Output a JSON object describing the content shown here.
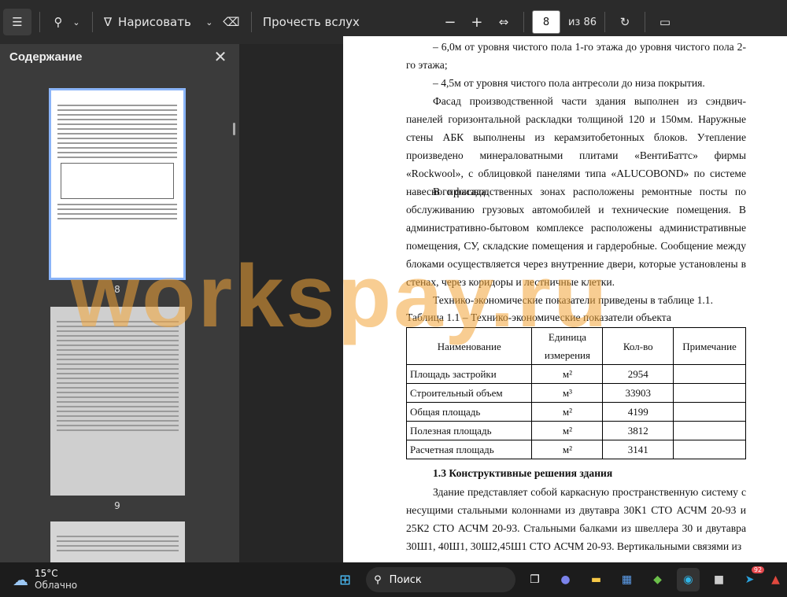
{
  "toolbar": {
    "draw_label": "Нарисовать",
    "read_aloud_label": "Прочесть вслух",
    "page_current": "8",
    "page_total": "из 86",
    "minus": "−",
    "plus": "+"
  },
  "sidebar": {
    "title": "Содержание",
    "pages": [
      "8",
      "9"
    ]
  },
  "document": {
    "lines": [
      "– 6,0м от уровня чистого пола 1-го этажа до уровня чистого пола 2-го этажа;",
      "– 4,5м от уровня чистого пола антресоли до низа покрытия.",
      "Фасад производственной части здания выполнен из сэндвич-панелей горизонтальной раскладки толщиной 120 и 150мм. Наружные стены АБК выполнены из керамзитобетонных блоков. Утепление произведено минераловатными плитами «ВентиБаттс» фирмы «Rockwool», с облицовкой панелями типа «ALUCOBOND» по системе навесного фасада.",
      "В производственных зонах расположены ремонтные посты по обслуживанию грузовых автомобилей и технические помещения. В административно-бытовом комплексе расположены административные помещения, СУ, складские помещения и гардеробные. Сообщение между блоками осуществляется через внутренние двери, которые установлены в стенах, через коридоры и лестничные клетки.",
      "Технико-экономические показатели приведены в таблице 1.1.",
      "Таблица 1.1 – Технико-экономические показатели объекта",
      "1.3 Конструктивные решения здания",
      "Здание представляет собой каркасную пространственную систему с несущими стальными колоннами из двутавра 30К1 СТО АСЧМ 20-93 и 25К2 СТО АСЧМ 20-93. Стальными балками из швеллера 30 и двутавра 30Ш1, 40Ш1, 30Ш2,45Ш1 СТО АСЧМ 20-93. Вертикальными связями из"
    ],
    "table": {
      "headers": [
        "Наименование",
        "Единица измерения",
        "Кол-во",
        "Примечание"
      ],
      "rows": [
        [
          "Площадь застройки",
          "м²",
          "2954",
          ""
        ],
        [
          "Строительный объем",
          "м³",
          "33903",
          ""
        ],
        [
          "Общая площадь",
          "м²",
          "4199",
          ""
        ],
        [
          "Полезная площадь",
          "м²",
          "3812",
          ""
        ],
        [
          "Расчетная площадь",
          "м²",
          "3141",
          ""
        ]
      ]
    }
  },
  "watermark": "workspay.ru",
  "taskbar": {
    "temperature": "15°C",
    "weather": "Облачно",
    "search_label": "Поиск",
    "badge": "92"
  }
}
